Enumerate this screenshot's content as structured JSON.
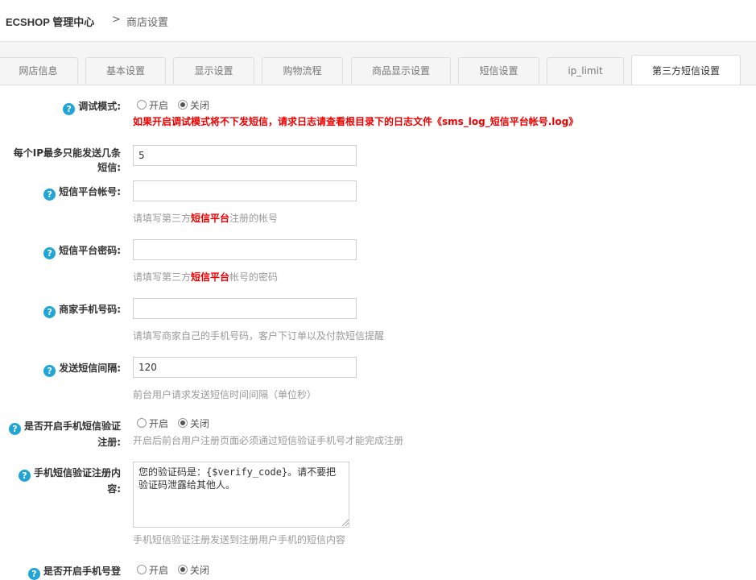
{
  "header": {
    "brand": "ECSHOP 管理中心",
    "separator": ">",
    "breadcrumb": "商店设置"
  },
  "tabs": [
    {
      "label": "网店信息"
    },
    {
      "label": "基本设置"
    },
    {
      "label": "显示设置"
    },
    {
      "label": "购物流程"
    },
    {
      "label": "商品显示设置"
    },
    {
      "label": "短信设置"
    },
    {
      "label": "ip_limit"
    },
    {
      "label": "第三方短信设置",
      "active": true
    }
  ],
  "form": {
    "debug_mode": {
      "label": "调试模式:",
      "option_on": "开启",
      "option_off": "关闭",
      "selected": "关闭",
      "warning": "如果开启调试模式将不下发短信，请求日志请查看根目录下的日志文件《sms_log_短信平台帐号.log》"
    },
    "ip_limit": {
      "label": "每个IP最多只能发送几条短信:",
      "value": "5"
    },
    "sms_account": {
      "label": "短信平台帐号:",
      "value": "",
      "hint_pre": "请填写第三方",
      "hint_highlight": "短信平台",
      "hint_post": "注册的帐号"
    },
    "sms_password": {
      "label": "短信平台密码:",
      "value": "",
      "hint_pre": "请填写第三方",
      "hint_highlight": "短信平台",
      "hint_post": "帐号的密码"
    },
    "merchant_phone": {
      "label": "商家手机号码:",
      "value": "",
      "hint": "请填写商家自己的手机号码，客户下订单以及付款短信提醒"
    },
    "send_interval": {
      "label": "发送短信间隔:",
      "value": "120",
      "hint": "前台用户请求发送短信时间间隔（单位秒）"
    },
    "register_verify": {
      "label": "是否开启手机短信验证注册:",
      "option_on": "开启",
      "option_off": "关闭",
      "selected": "关闭",
      "hint": "开启后前台用户注册页面必须通过短信验证手机号才能完成注册"
    },
    "register_content": {
      "label": "手机短信验证注册内容:",
      "value": "您的验证码是：{$verify_code}。请不要把验证码泄露给其他人。",
      "hint": "手机短信验证注册发送到注册用户手机的短信内容"
    },
    "login_verify": {
      "label": "是否开启手机号登",
      "option_on": "开启",
      "option_off": "关闭",
      "selected": "关闭"
    }
  },
  "colors": {
    "accent": "#21a5d7",
    "warning": "#ee0000",
    "hint": "#999999"
  }
}
